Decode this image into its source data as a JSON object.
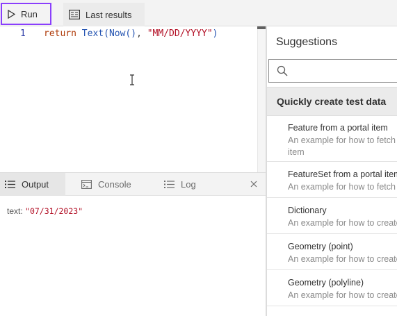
{
  "toolbar": {
    "run_label": "Run",
    "last_results_label": "Last results"
  },
  "editor": {
    "line_number": "1",
    "code": {
      "keyword": "return",
      "fn_text": "Text",
      "paren_open": "(",
      "fn_now": "Now",
      "now_parens": "()",
      "comma": ",",
      "format": "\"MM/DD/YYYY\"",
      "paren_close": ")"
    }
  },
  "output_panel": {
    "tabs": [
      {
        "label": "Output",
        "icon": "list-icon",
        "active": true
      },
      {
        "label": "Console",
        "icon": "console-icon",
        "active": false
      },
      {
        "label": "Log",
        "icon": "log-list-icon",
        "active": false
      }
    ],
    "result_key": "text:",
    "result_value": "\"07/31/2023\""
  },
  "suggestions": {
    "title": "Suggestions",
    "search_placeholder": "",
    "group_title": "Quickly create test data",
    "items": [
      {
        "title": "Feature from a portal item",
        "desc": "An example for how to fetch",
        "desc2": "item"
      },
      {
        "title": "FeatureSet from a portal item",
        "desc": "An example for how to fetch"
      },
      {
        "title": "Dictionary",
        "desc": "An example for how to create"
      },
      {
        "title": "Geometry (point)",
        "desc": "An example for how to create"
      },
      {
        "title": "Geometry (polyline)",
        "desc": "An example for how to create"
      }
    ]
  },
  "colors": {
    "run_border": "#8a3ffc",
    "keyword": "#af3a08",
    "function": "#2353b1",
    "string": "#b20e24"
  }
}
